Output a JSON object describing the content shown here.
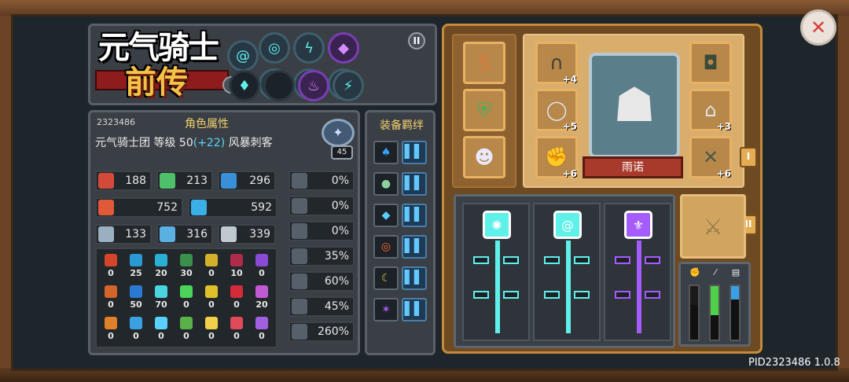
{
  "logo": {
    "title_line1": "元气骑士",
    "title_line2": "前传"
  },
  "talents": {
    "roman_1": "I",
    "roman_2": "II",
    "nodes": [
      {
        "icon": "spiral-icon",
        "glyph": "@",
        "style": "cyan"
      },
      {
        "icon": "ring-icon",
        "glyph": "◎",
        "style": "cyan"
      },
      {
        "icon": "lightning-icon",
        "glyph": "ϟ",
        "style": "cyan"
      },
      {
        "icon": "crystal-icon",
        "glyph": "◆",
        "style": "purple"
      },
      {
        "icon": "vortex-icon",
        "glyph": "◉",
        "style": "cyan"
      },
      {
        "icon": "spark-icon",
        "glyph": "✧",
        "style": "cyan"
      },
      {
        "icon": "sun-icon",
        "glyph": "✺",
        "style": "cyan"
      },
      {
        "icon": "potion-icon",
        "glyph": "♦",
        "style": "empty"
      },
      {
        "icon": "empty-slot",
        "glyph": "",
        "style": "empty"
      },
      {
        "icon": "flame-icon",
        "glyph": "♨",
        "style": "purple"
      },
      {
        "icon": "claw-icon",
        "glyph": "⚡",
        "style": "cyan"
      }
    ]
  },
  "stats": {
    "player_id": "2323486",
    "title": "角色属性",
    "guild": "元气骑士团",
    "level_label": "等级",
    "level": "50",
    "level_bonus": "(+22)",
    "class": "风暴刺客",
    "badge_level": "45",
    "rows": [
      {
        "icon": "fist-icon",
        "value": "188"
      },
      {
        "icon": "feather-icon",
        "value": "213"
      },
      {
        "icon": "book-icon",
        "value": "296"
      },
      {
        "icon": "heart-icon",
        "value": "752"
      },
      {
        "icon": "droplet-icon",
        "value": "592"
      },
      {
        "icon": "sword-icon",
        "value": "133"
      },
      {
        "icon": "staff-icon",
        "value": "316"
      },
      {
        "icon": "shield-icon",
        "value": "339"
      }
    ],
    "side": [
      {
        "icon": "arrow-up-icon",
        "value": "0%"
      },
      {
        "icon": "arrow-up-icon",
        "value": "0%"
      },
      {
        "icon": "crossed-swords-icon",
        "value": "0%"
      },
      {
        "icon": "boot-icon",
        "value": "35%"
      },
      {
        "icon": "clock-icon",
        "value": "60%"
      },
      {
        "icon": "target-icon",
        "value": "45%"
      },
      {
        "icon": "crit-icon",
        "value": "260%"
      }
    ],
    "elements": [
      [
        "0",
        "25",
        "20",
        "30",
        "0",
        "10",
        "0"
      ],
      [
        "0",
        "50",
        "70",
        "0",
        "0",
        "0",
        "20"
      ],
      [
        "0",
        "0",
        "0",
        "0",
        "0",
        "0",
        "0"
      ]
    ]
  },
  "bonds": {
    "title": "装备羁绊",
    "items": [
      {
        "icon": "blue-flame-icon",
        "glyph": "♠"
      },
      {
        "icon": "green-orb-icon",
        "glyph": "●"
      },
      {
        "icon": "diamond-icon",
        "glyph": "◆"
      },
      {
        "icon": "red-ring-icon",
        "glyph": "◎"
      },
      {
        "icon": "golden-arc-icon",
        "glyph": "☾"
      },
      {
        "icon": "purple-star-icon",
        "glyph": "✶"
      }
    ],
    "bar_glyph": "▌▌"
  },
  "equipment": {
    "hero_name": "雨诺",
    "tab_1": "I",
    "tab_2": "II",
    "left_slots": [
      {
        "icon": "horn-icon",
        "glyph": "S",
        "bonus": ""
      },
      {
        "icon": "armor-icon",
        "glyph": "⛨",
        "bonus": ""
      },
      {
        "icon": "ghost-icon",
        "glyph": "☻",
        "bonus": ""
      }
    ],
    "mid_slots": [
      {
        "icon": "necklace-icon",
        "glyph": "∩",
        "bonus": "+4"
      },
      {
        "icon": "ring-item-icon",
        "glyph": "◯",
        "bonus": "+5"
      },
      {
        "icon": "gauntlet-icon",
        "glyph": "✊",
        "bonus": "+6"
      }
    ],
    "right_slots": [
      {
        "icon": "chestplate-icon",
        "glyph": "◘",
        "bonus": ""
      },
      {
        "icon": "helmet-icon",
        "glyph": "⌂",
        "bonus": "+3"
      },
      {
        "icon": "blades-icon",
        "glyph": "✕",
        "bonus": "+6"
      }
    ]
  },
  "skills": {
    "trees": [
      {
        "glyph": "✺",
        "color": "#5ff0ea"
      },
      {
        "glyph": "@",
        "color": "#5ff0ea"
      },
      {
        "glyph": "⚜",
        "color": "#a55cff"
      }
    ]
  },
  "meters": {
    "icons": [
      {
        "icon": "fist-meter-icon",
        "glyph": "✊"
      },
      {
        "icon": "feather-meter-icon",
        "glyph": "⁄"
      },
      {
        "icon": "book-meter-icon",
        "glyph": "▤"
      }
    ],
    "fill_fraction": [
      0.35,
      0.55,
      0.25
    ],
    "colors": [
      "#1a1a1a",
      "#4fd04a",
      "#3aa0e6"
    ]
  },
  "footer": {
    "version": "PID2323486 1.0.8"
  }
}
